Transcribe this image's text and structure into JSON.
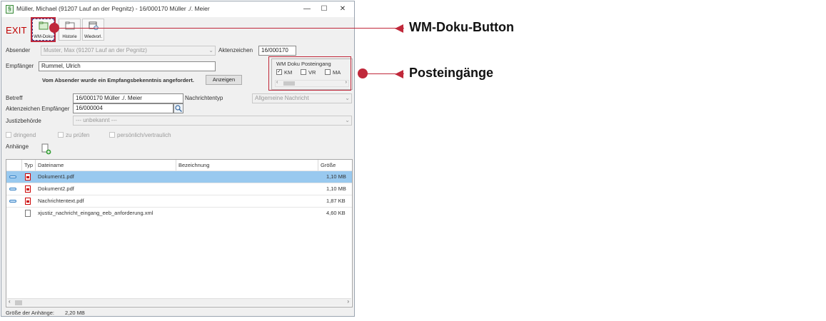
{
  "window": {
    "title": "Müller, Michael (91207 Lauf an der Pegnitz) - 16/000170 Müller ./. Meier",
    "minimize": "—",
    "maximize": "☐",
    "close": "✕"
  },
  "toolbar": {
    "exit_label": "EXIT",
    "buttons": [
      {
        "label": "WM-Doku"
      },
      {
        "label": "Historie"
      },
      {
        "label": "Wiedvorl."
      }
    ]
  },
  "form": {
    "absender_label": "Absender",
    "absender_value": "Muster, Max (91207 Lauf an der Pegnitz)",
    "aktenzeichen_label": "Aktenzeichen",
    "aktenzeichen_value": "16/000170",
    "empfaenger_label": "Empfänger",
    "empfaenger_value": "Rummel, Ulrich",
    "bekenntnis_text": "Vom Absender wurde ein Empfangsbekenntnis angefordert.",
    "anzeigen_button": "Anzeigen",
    "betreff_label": "Betreff",
    "betreff_value": "16/000170 Müller ./. Meier",
    "nachrichtentyp_label": "Nachrichtentyp",
    "nachrichtentyp_value": "Allgemeine Nachricht",
    "az_empfaenger_label": "Aktenzeichen Empfänger",
    "az_empfaenger_value": "16/000004",
    "justiz_label": "Justizbehörde",
    "justiz_value": "--- unbekannt ---",
    "flags": [
      "dringend",
      "zu prüfen",
      "persönlich/vertraulich"
    ],
    "anhaenge_label": "Anhänge"
  },
  "posteingang": {
    "title": "WM Doku Posteingang",
    "options": [
      {
        "label": "KM",
        "checked": true
      },
      {
        "label": "VR",
        "checked": false
      },
      {
        "label": "MA",
        "checked": false
      }
    ]
  },
  "table": {
    "columns": [
      "Typ",
      "Dateiname",
      "Bezeichnung",
      "Größe"
    ],
    "rows": [
      {
        "name": "Dokument1.pdf",
        "bezeichnung": "",
        "size": "1,10 MB",
        "type": "pdf",
        "flag": true,
        "selected": true
      },
      {
        "name": "Dokument2.pdf",
        "bezeichnung": "",
        "size": "1,10 MB",
        "type": "pdf",
        "flag": true,
        "selected": false
      },
      {
        "name": "Nachrichtentext.pdf",
        "bezeichnung": "",
        "size": "1,87 KB",
        "type": "pdf",
        "flag": true,
        "selected": false
      },
      {
        "name": "xjustiz_nachricht_eingang_eeb_anforderung.xml",
        "bezeichnung": "",
        "size": "4,60 KB",
        "type": "xml",
        "flag": false,
        "selected": false
      }
    ]
  },
  "status": {
    "label": "Größe der Anhänge:",
    "value": "2,20 MB"
  },
  "callouts": [
    {
      "text": "WM-Doku-Button"
    },
    {
      "text": "Posteingänge"
    }
  ],
  "colors": {
    "accent_red": "#c0283a",
    "selection": "#99c9ef",
    "exit_red": "#c00000"
  }
}
